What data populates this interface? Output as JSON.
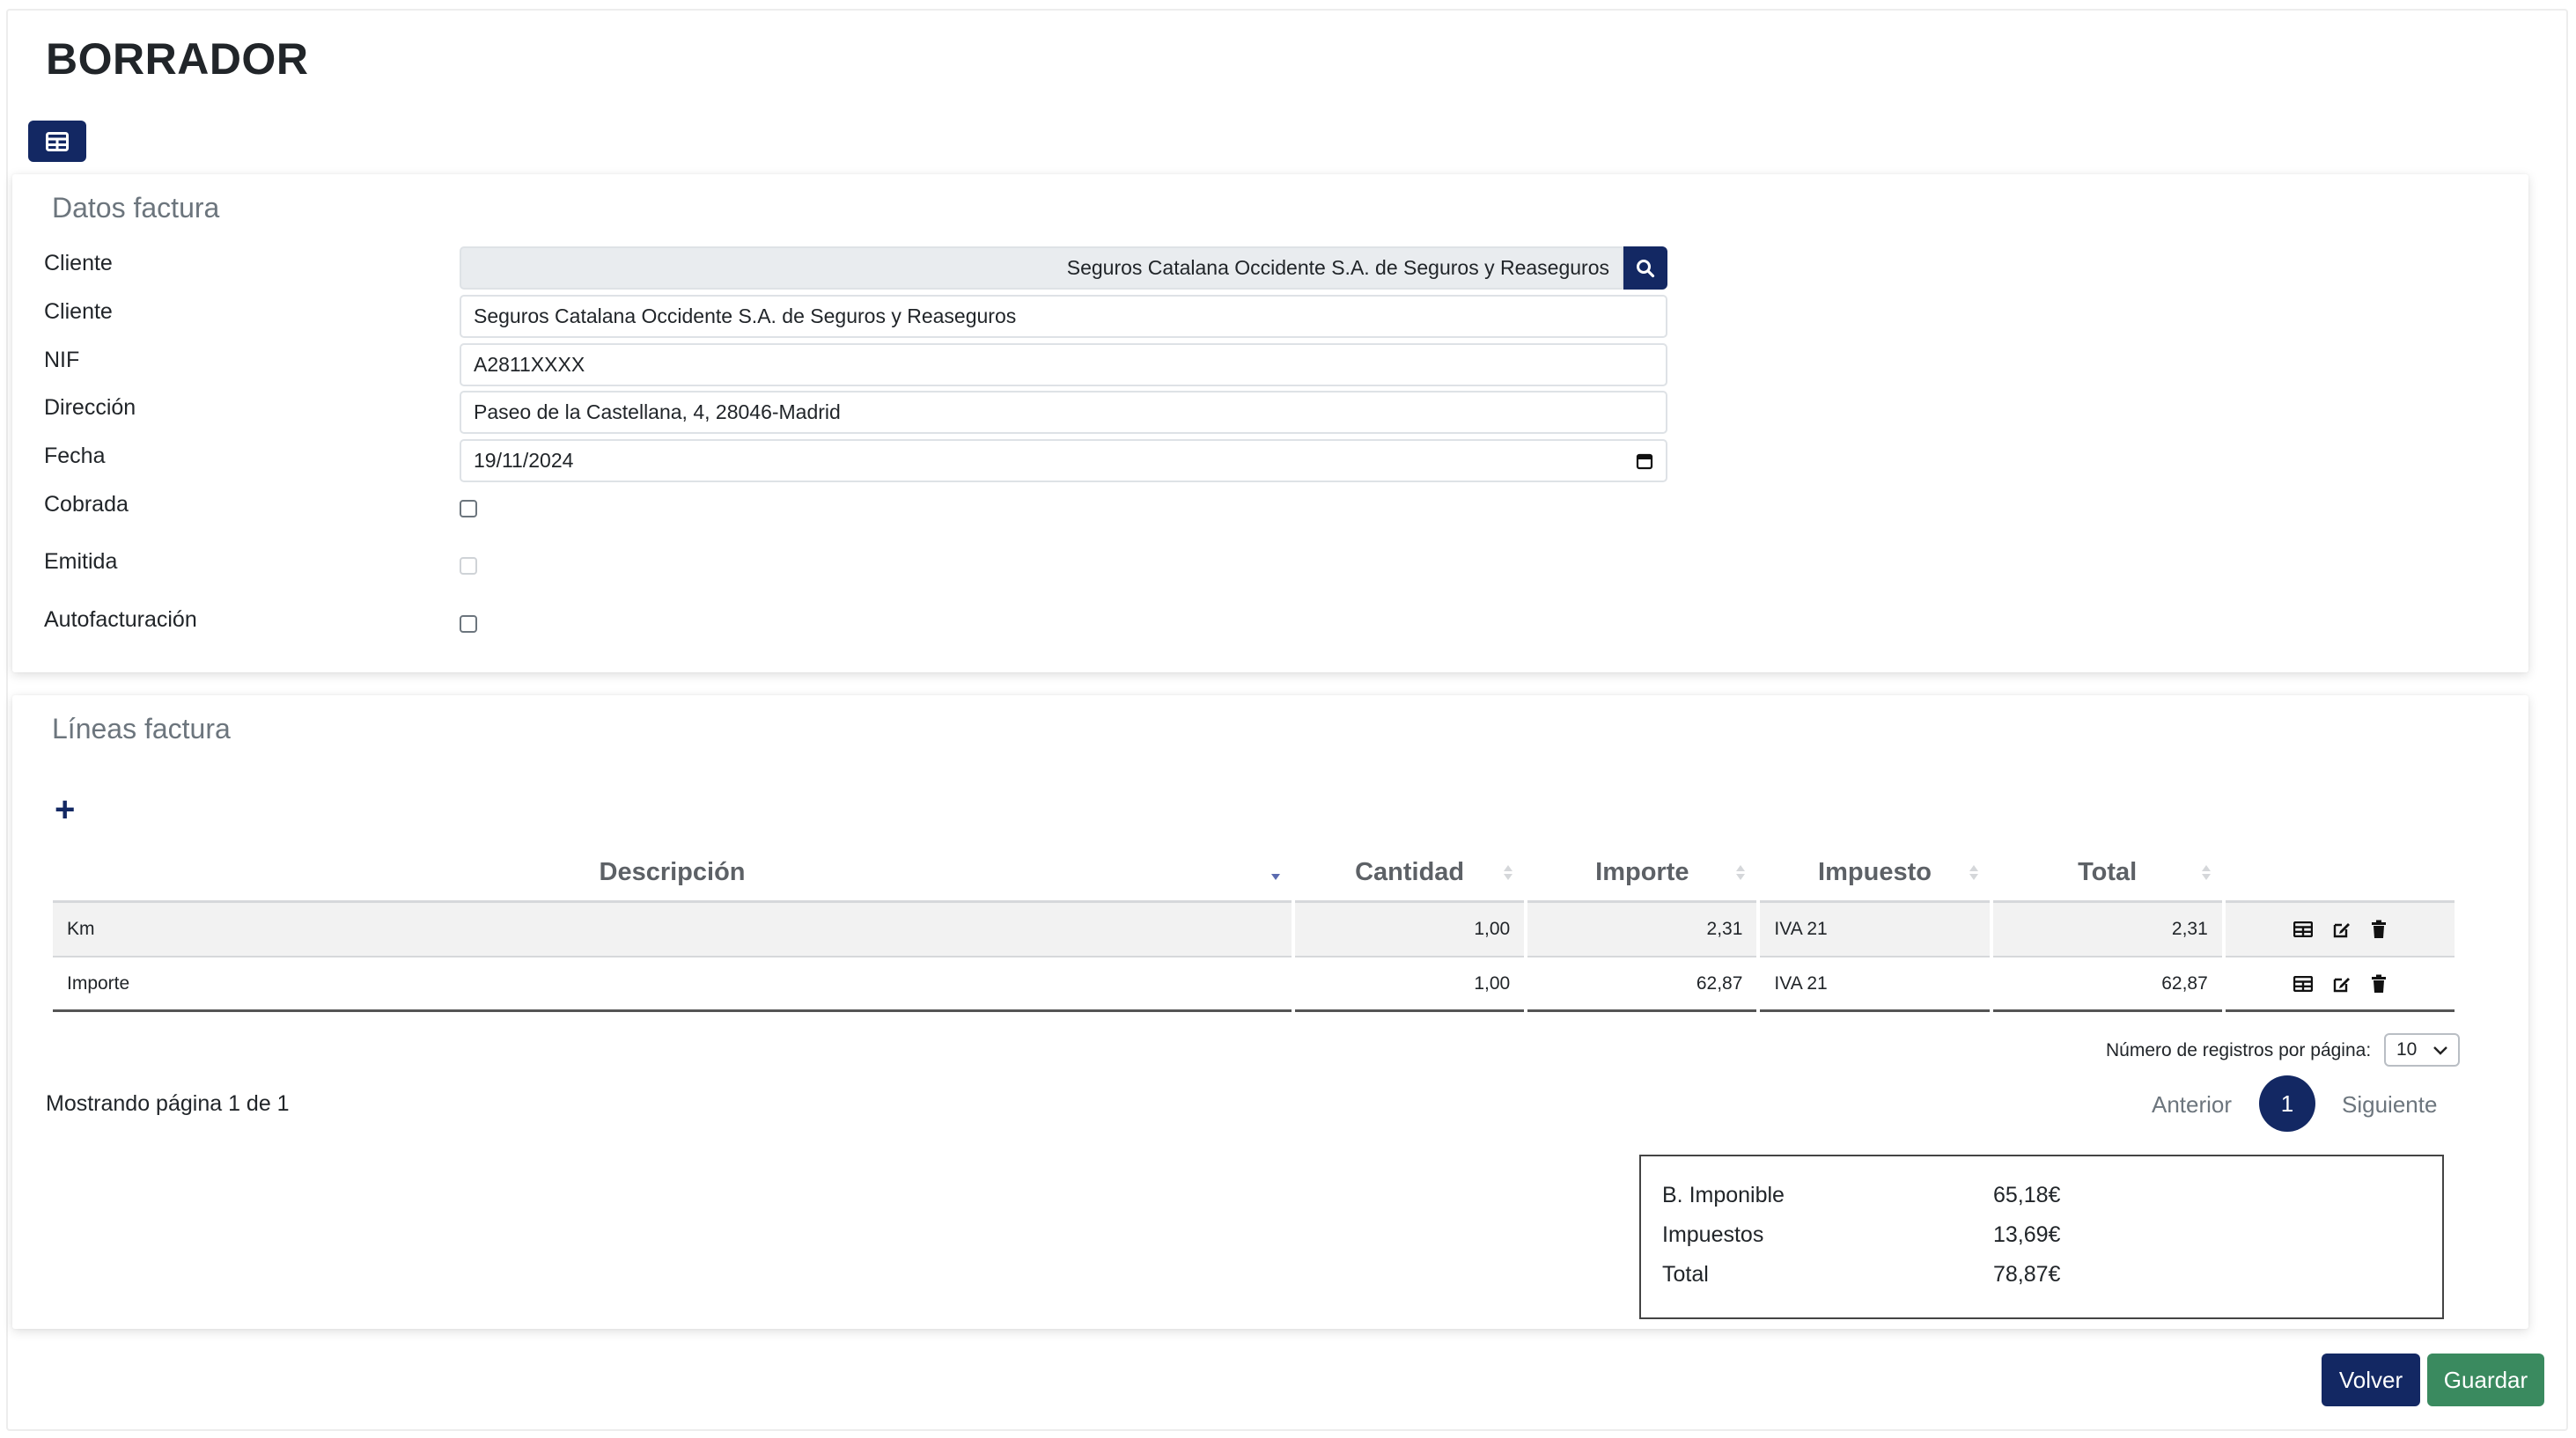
{
  "page": {
    "title": "BORRADOR"
  },
  "toolbar": {
    "grid_icon": "table-grid-icon"
  },
  "datos": {
    "title": "Datos factura",
    "cliente_label": "Cliente",
    "cliente_search_value": "Seguros Catalana Occidente S.A. de Seguros y Reaseguros",
    "cliente2_label": "Cliente",
    "cliente2_value": "Seguros Catalana Occidente S.A. de Seguros y Reaseguros",
    "nif_label": "NIF",
    "nif_value": "A2811XXXX",
    "direccion_label": "Dirección",
    "direccion_value": "Paseo de la Castellana, 4, 28046-Madrid",
    "fecha_label": "Fecha",
    "fecha_value": "19/11/2024",
    "cobrada_label": "Cobrada",
    "cobrada_checked": false,
    "emitida_label": "Emitida",
    "emitida_checked": false,
    "autofacturacion_label": "Autofacturación",
    "autofacturacion_checked": false
  },
  "lineas": {
    "title": "Líneas factura",
    "add_label": "+",
    "columns": [
      "Descripción",
      "Cantidad",
      "Importe",
      "Impuesto",
      "Total"
    ],
    "rows": [
      {
        "descripcion": "Km",
        "cantidad": "1,00",
        "importe": "2,31",
        "impuesto": "IVA 21",
        "total": "2,31"
      },
      {
        "descripcion": "Importe",
        "cantidad": "1,00",
        "importe": "62,87",
        "impuesto": "IVA 21",
        "total": "62,87"
      }
    ],
    "per_page_label": "Número de registros por página:",
    "per_page_value": "10",
    "showing": "Mostrando página 1 de 1",
    "prev": "Anterior",
    "current_page": "1",
    "next": "Siguiente"
  },
  "totals": {
    "base_label": "B. Imponible",
    "base_value": "65,18€",
    "impuestos_label": "Impuestos",
    "impuestos_value": "13,69€",
    "total_label": "Total",
    "total_value": "78,87€"
  },
  "footer": {
    "volver": "Volver",
    "guardar": "Guardar"
  },
  "colors": {
    "primary": "#132863",
    "success": "#3a8a5f",
    "muted": "#6c757d"
  }
}
